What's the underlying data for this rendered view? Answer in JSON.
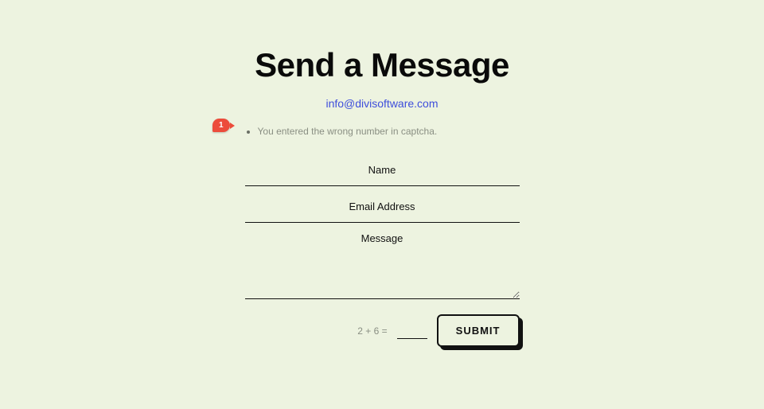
{
  "header": {
    "title": "Send a Message",
    "email": "info@divisoftware.com"
  },
  "annotation": {
    "badge": "1"
  },
  "error": {
    "message": "You entered the wrong number in captcha."
  },
  "form": {
    "name_placeholder": "Name",
    "email_placeholder": "Email Address",
    "message_placeholder": "Message",
    "captcha_expression": "2 + 6",
    "captcha_equals": "=",
    "submit_label": "SUBMIT"
  }
}
